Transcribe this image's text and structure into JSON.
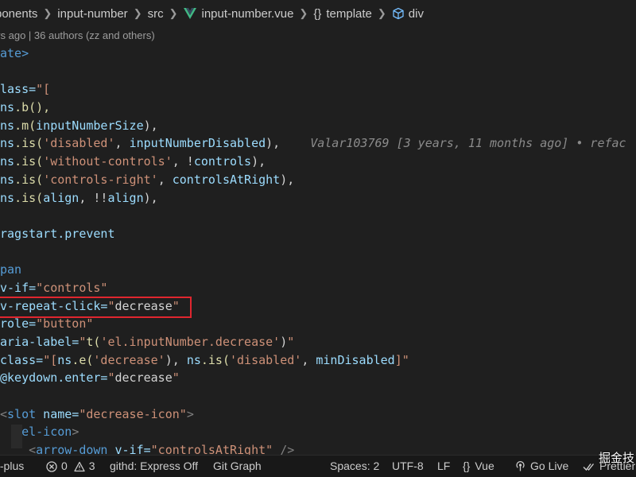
{
  "breadcrumb": {
    "items": [
      "ponents",
      "input-number",
      "src",
      "input-number.vue",
      "template",
      "div"
    ]
  },
  "codelens": {
    "text": "ys ago | 36 authors (zz and others)"
  },
  "code": {
    "l01": "ate>",
    "l03a": "lass=",
    "l03b": "\"[",
    "l04a": "ns",
    "l04b": ".b(),",
    "l05a": "ns",
    "l05b": ".m(",
    "l05c": "inputNumberSize",
    "l05d": "),",
    "l06a": "ns",
    "l06b": ".is(",
    "l06c": "'disabled'",
    "l06d": ", ",
    "l06e": "inputNumberDisabled",
    "l06f": "),",
    "blame": "Valar103769 [3 years, 11 months ago] • refac",
    "l07a": "ns",
    "l07b": ".is(",
    "l07c": "'without-controls'",
    "l07d": ", !",
    "l07e": "controls",
    "l07f": "),",
    "l08a": "ns",
    "l08b": ".is(",
    "l08c": "'controls-right'",
    "l08d": ", ",
    "l08e": "controlsAtRight",
    "l08f": "),",
    "l09a": "ns",
    "l09b": ".is(",
    "l09c": "align",
    "l09d": ", !!",
    "l09e": "align",
    "l09f": "),",
    "l11": "ragstart.prevent",
    "l13": "pan",
    "l14a": "v-if=",
    "l14b": "\"controls\"",
    "l15a": "v-repeat-click=",
    "l15b": "\"",
    "l15c": "decrease",
    "l15d": "\"",
    "l16a": "role=",
    "l16b": "\"button\"",
    "l17a": "aria-label=",
    "l17b": "\"",
    "l17c": "t(",
    "l17d": "'el.inputNumber.decrease'",
    "l17e": ")",
    "l17f": "\"",
    "l18a": "class=",
    "l18b": "\"[",
    "l18c": "ns",
    "l18d": ".e(",
    "l18e": "'decrease'",
    "l18f": "), ",
    "l18g": "ns",
    "l18h": ".is(",
    "l18i": "'disabled'",
    "l18j": ", ",
    "l18k": "minDisabled",
    "l18l": "]\"",
    "l19a": "@keydown.enter=",
    "l19b": "\"",
    "l19c": "decrease",
    "l19d": "\"",
    "l21a": "<",
    "l21b": "slot",
    "l21c": " name=",
    "l21d": "\"decrease-icon\"",
    "l21e": ">",
    "l22a": "<",
    "l22b": "el-icon",
    "l22c": ">",
    "l23a": "<",
    "l23b": "arrow-down",
    "l23c": " v-if=",
    "l23d": "\"controlsAtRight\"",
    "l23e": " />"
  },
  "statusbar": {
    "branch": "t-plus",
    "errors": "0",
    "warnings": "3",
    "githd": "githd: Express Off",
    "git_graph": "Git Graph",
    "spaces": "Spaces: 2",
    "encoding": "UTF-8",
    "eol": "LF",
    "language": "Vue",
    "golive": "Go Live",
    "prettier": "Prettier"
  },
  "watermark": "掘金技"
}
